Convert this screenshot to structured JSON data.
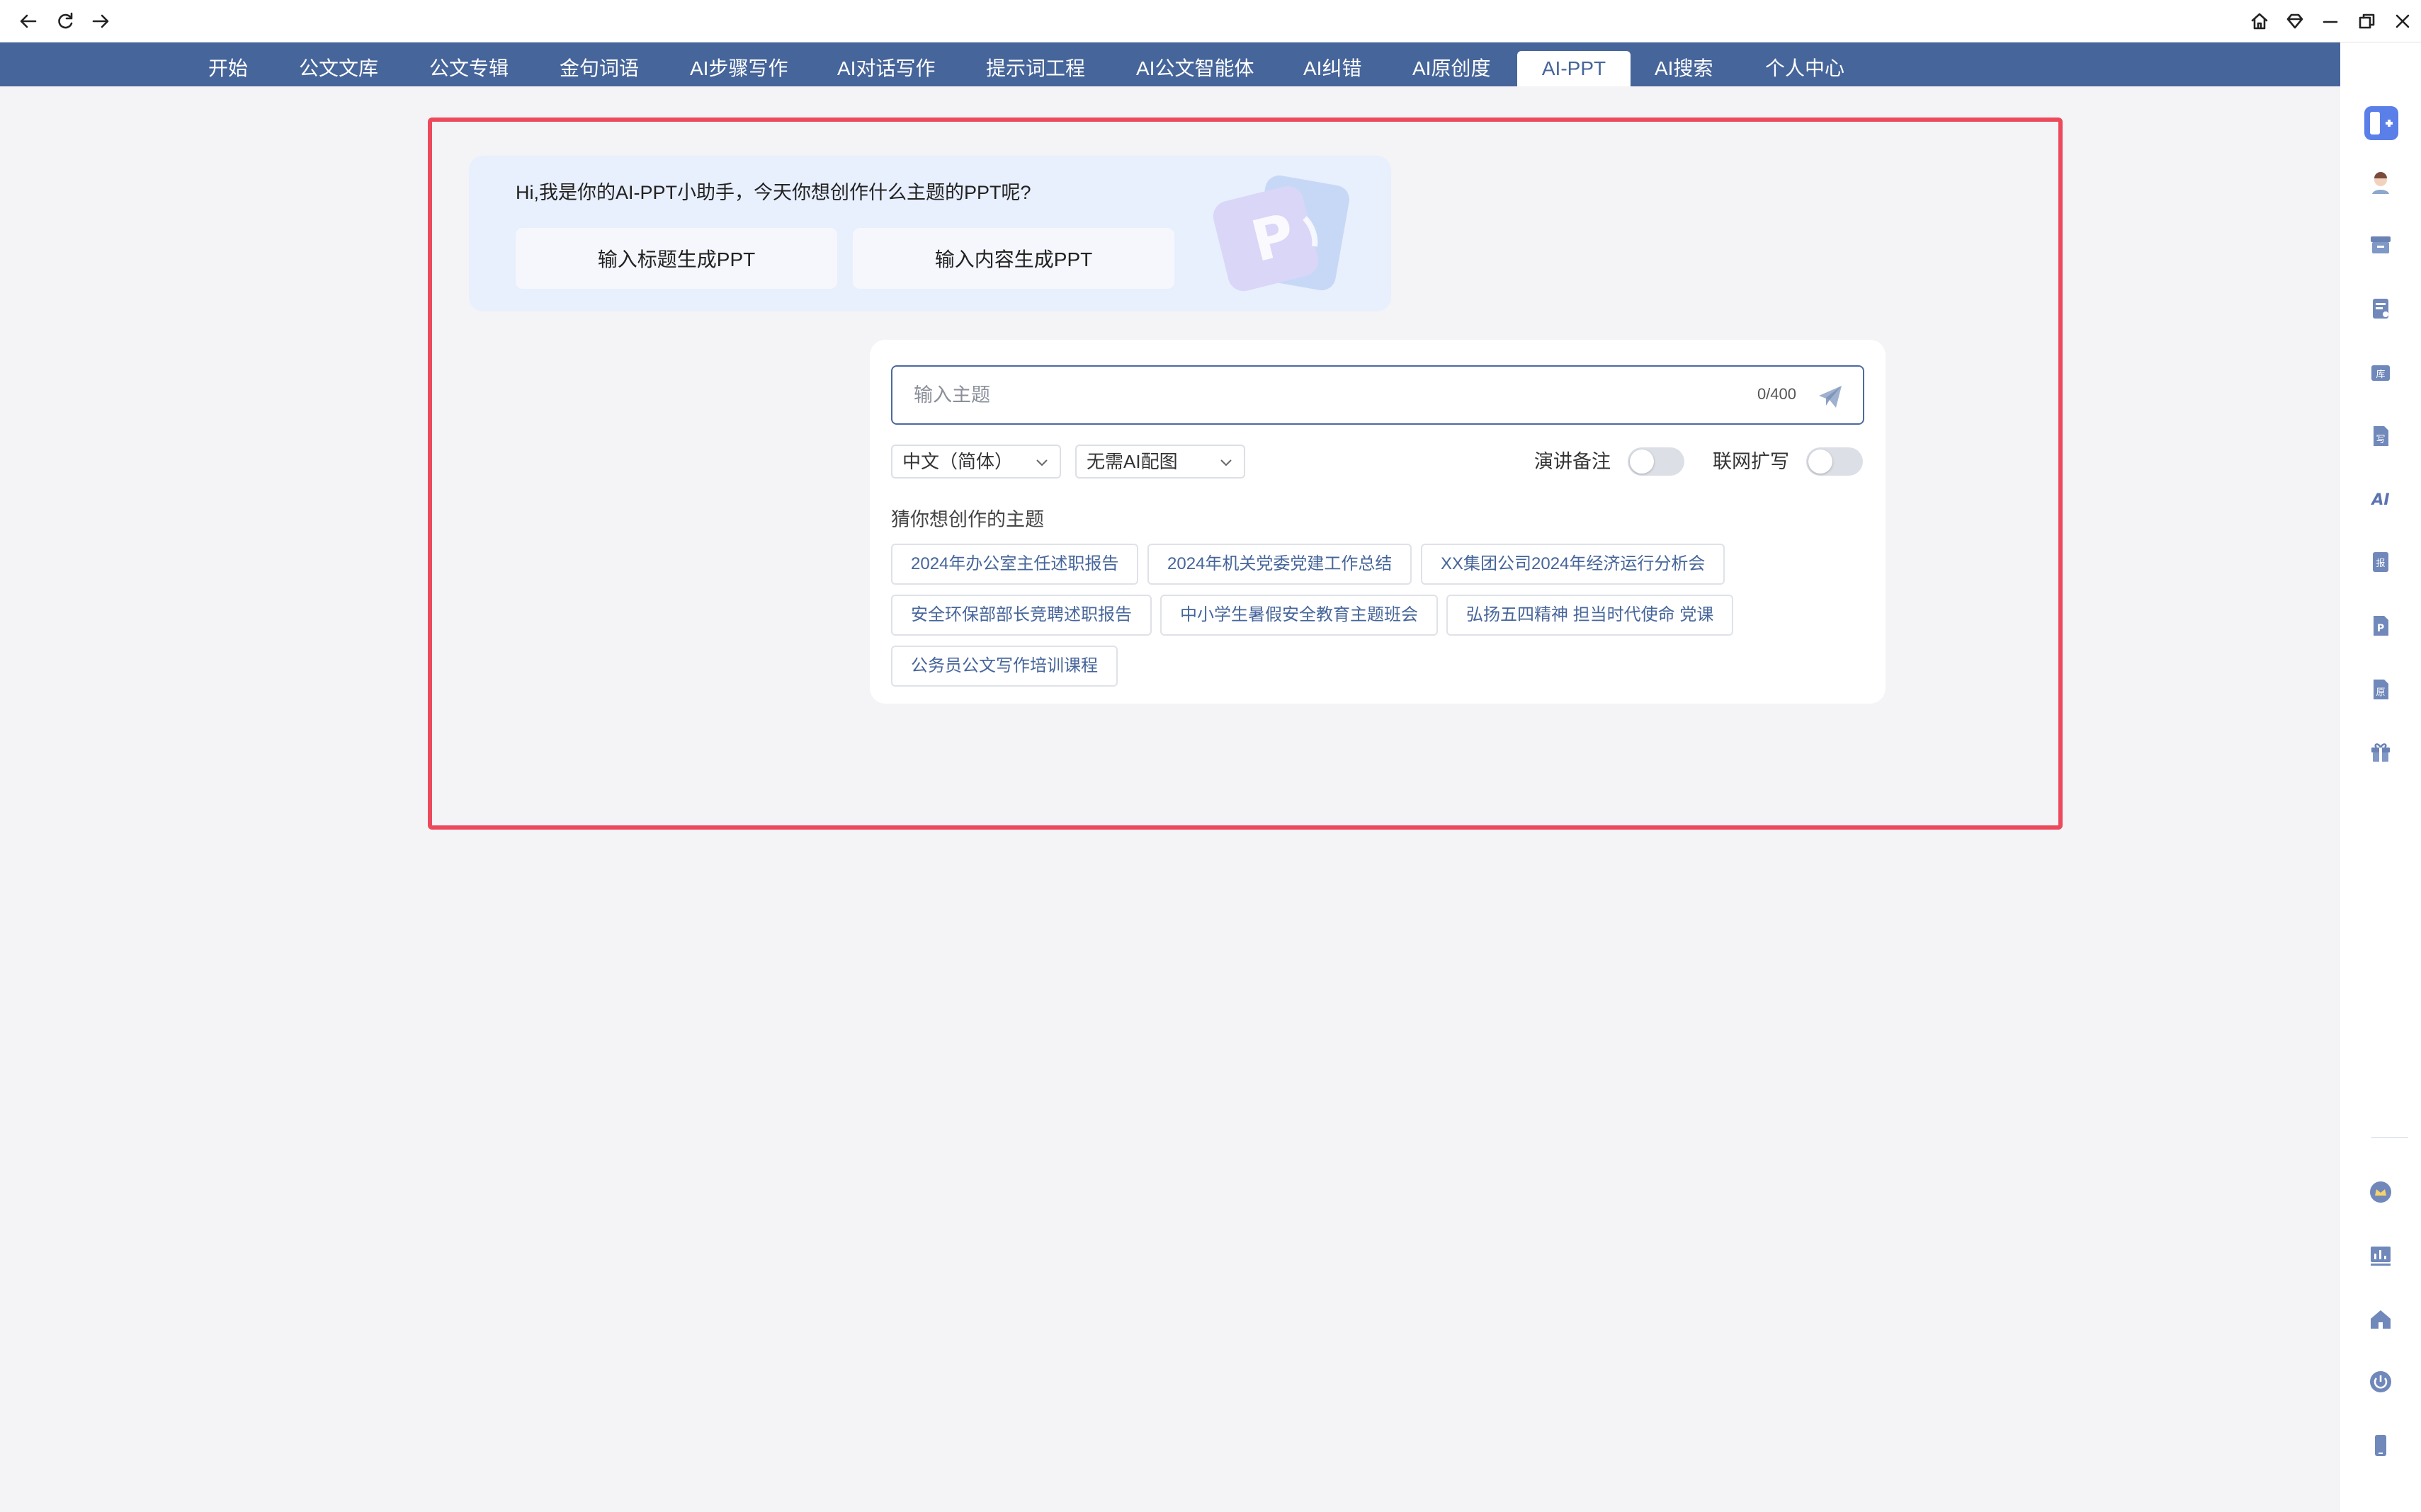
{
  "nav": {
    "items": [
      {
        "label": "开始"
      },
      {
        "label": "公文文库"
      },
      {
        "label": "公文专辑"
      },
      {
        "label": "金句词语"
      },
      {
        "label": "AI步骤写作"
      },
      {
        "label": "AI对话写作"
      },
      {
        "label": "提示词工程"
      },
      {
        "label": "AI公文智能体"
      },
      {
        "label": "AI纠错"
      },
      {
        "label": "AI原创度"
      },
      {
        "label": "AI-PPT"
      },
      {
        "label": "AI搜索"
      },
      {
        "label": "个人中心"
      }
    ],
    "active": "AI-PPT",
    "bar_color": "#46659a"
  },
  "welcome": {
    "greeting": "Hi,我是你的AI-PPT小助手，今天你想创作什么主题的PPT呢?",
    "buttons": [
      {
        "label": "输入标题生成PPT"
      },
      {
        "label": "输入内容生成PPT"
      }
    ],
    "art_letter": "P"
  },
  "input": {
    "placeholder": "输入主题",
    "value": "",
    "counter": "0/400"
  },
  "options": {
    "language": "中文（简体）",
    "image": "无需AI配图",
    "toggles": [
      {
        "label": "演讲备注",
        "on": false
      },
      {
        "label": "联网扩写",
        "on": false
      }
    ]
  },
  "suggestions": {
    "title": "猜你想创作的主题",
    "items": [
      "2024年办公室主任述职报告",
      "2024年机关党委党建工作总结",
      "XX集团公司2024年经济运行分析会",
      "安全环保部部长竞聘述职报告",
      "中小学生暑假安全教育主题班会",
      "弘扬五四精神 担当时代使命 党课",
      "公务员公文写作培训课程"
    ]
  },
  "colors": {
    "accent": "#46659a",
    "highlight": "#ec4a5c",
    "welcome_bg": "#e8effd"
  },
  "icons": {
    "titlebar": [
      "back-arrow-icon",
      "refresh-icon",
      "forward-arrow-icon",
      "home-icon",
      "diamond-icon",
      "minimize-icon",
      "restore-icon",
      "close-icon"
    ],
    "sidebar": [
      "panel-toggle-icon",
      "avatar-icon",
      "archive-icon",
      "document-icon",
      "library-icon",
      "write-icon",
      "ai-icon",
      "report-icon",
      "ppt-icon",
      "original-icon",
      "gift-icon",
      "crown-icon",
      "stats-icon",
      "house-icon",
      "power-icon",
      "phone-icon"
    ]
  }
}
